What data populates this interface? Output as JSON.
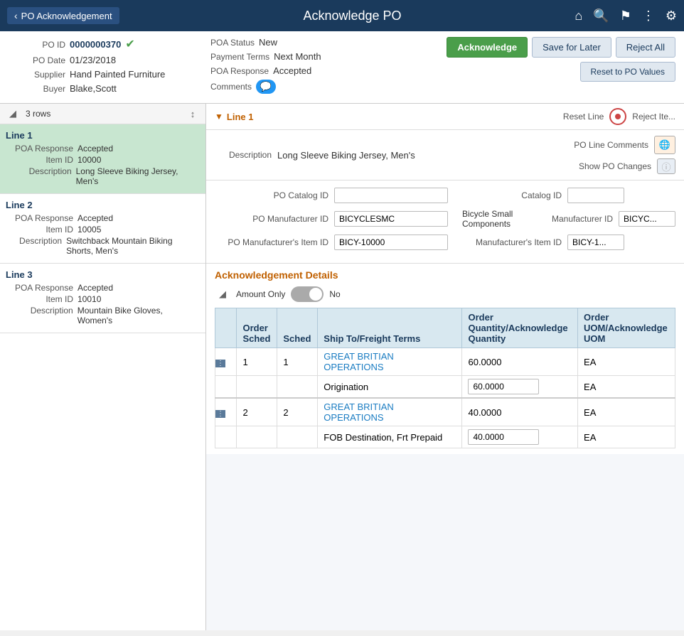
{
  "header": {
    "back_label": "PO Acknowledgement",
    "title": "Acknowledge PO",
    "icons": [
      "home",
      "search",
      "flag",
      "more",
      "settings"
    ]
  },
  "info": {
    "po_id_label": "PO ID",
    "po_id_value": "0000000370",
    "po_date_label": "PO Date",
    "po_date_value": "01/23/2018",
    "supplier_label": "Supplier",
    "supplier_value": "Hand Painted Furniture",
    "buyer_label": "Buyer",
    "buyer_value": "Blake,Scott",
    "poa_status_label": "POA Status",
    "poa_status_value": "New",
    "payment_terms_label": "Payment Terms",
    "payment_terms_value": "Next Month",
    "poa_response_label": "POA Response",
    "poa_response_value": "Accepted",
    "comments_label": "Comments"
  },
  "buttons": {
    "acknowledge": "Acknowledge",
    "save_for_later": "Save for Later",
    "reject_all": "Reject All",
    "reset_to_po_values": "Reset to PO Values"
  },
  "sidebar": {
    "rows_label": "3 rows",
    "lines": [
      {
        "title": "Line 1",
        "poa_response_label": "POA Response",
        "poa_response_value": "Accepted",
        "item_id_label": "Item ID",
        "item_id_value": "10000",
        "description_label": "Description",
        "description_value": "Long Sleeve Biking Jersey, Men's",
        "active": true
      },
      {
        "title": "Line 2",
        "poa_response_label": "POA Response",
        "poa_response_value": "Accepted",
        "item_id_label": "Item ID",
        "item_id_value": "10005",
        "description_label": "Description",
        "description_value": "Switchback Mountain Biking Shorts, Men's",
        "active": false
      },
      {
        "title": "Line 3",
        "poa_response_label": "POA Response",
        "poa_response_value": "Accepted",
        "item_id_label": "Item ID",
        "item_id_value": "10010",
        "description_label": "Description",
        "description_value": "Mountain Bike Gloves, Women's",
        "active": false
      }
    ]
  },
  "content": {
    "line_title": "Line 1",
    "reset_line_label": "Reset Line",
    "reject_item_label": "Reject Ite...",
    "description_label": "Description",
    "description_value": "Long Sleeve Biking Jersey, Men's",
    "po_line_comments_label": "PO Line Comments",
    "show_po_changes_label": "Show PO Changes",
    "po_catalog_id_label": "PO Catalog ID",
    "po_catalog_id_value": "",
    "catalog_id_label": "Catalog ID",
    "catalog_id_value": "",
    "po_manufacturer_id_label": "PO Manufacturer ID",
    "po_manufacturer_id_value": "BICYCLESMC",
    "manufacturer_desc": "Bicycle Small Components",
    "manufacturer_id_label": "Manufacturer ID",
    "manufacturer_id_value": "BICYC...",
    "po_mfr_item_id_label": "PO Manufacturer's Item ID",
    "po_mfr_item_id_value": "BICY-10000",
    "mfr_item_id_label": "Manufacturer's Item ID",
    "mfr_item_id_value": "BICY-1...",
    "ack_details_title": "Acknowledgement Details",
    "amount_only_label": "Amount Only",
    "toggle_label": "No",
    "table": {
      "col1": "Order Sched",
      "col2": "Sched",
      "col3": "Ship To/Freight Terms",
      "col4": "Order Quantity/Acknowledge Quantity",
      "col5": "Order UOM/Acknowledge UOM",
      "rows": [
        {
          "order_sched": "1",
          "sched": "1",
          "ship_to": "GREAT BRITIAN OPERATIONS",
          "freight_terms": "Origination",
          "order_qty": "60.0000",
          "ack_qty": "60.0000",
          "order_uom": "EA",
          "ack_uom": "EA"
        },
        {
          "order_sched": "2",
          "sched": "2",
          "ship_to": "GREAT BRITIAN OPERATIONS",
          "freight_terms": "FOB Destination, Frt Prepaid",
          "order_qty": "40.0000",
          "ack_qty": "40.0000",
          "order_uom": "EA",
          "ack_uom": "EA"
        }
      ]
    }
  }
}
